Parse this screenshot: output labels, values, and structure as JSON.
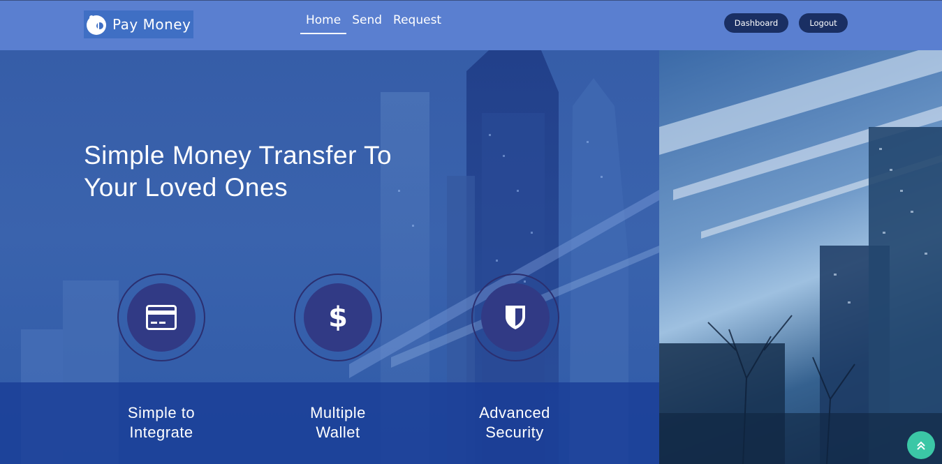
{
  "brand": {
    "name": "Pay Money"
  },
  "nav": {
    "links": [
      {
        "label": "Home",
        "active": true
      },
      {
        "label": "Send",
        "active": false
      },
      {
        "label": "Request",
        "active": false
      }
    ],
    "dashboard_label": "Dashboard",
    "logout_label": "Logout"
  },
  "hero": {
    "title_line1": "Simple Money Transfer To",
    "title_line2": "Your Loved Ones"
  },
  "features": [
    {
      "icon": "credit-card-icon",
      "line1": "Simple to",
      "line2": "Integrate"
    },
    {
      "icon": "dollar-icon",
      "line1": "Multiple",
      "line2": "Wallet"
    },
    {
      "icon": "shield-icon",
      "line1": "Advanced",
      "line2": "Security"
    }
  ],
  "colors": {
    "navbar": "#5a7fd0",
    "button": "#1a2f63",
    "feature_circle": "#313a85",
    "scroll_top": "#3bc7a6"
  }
}
